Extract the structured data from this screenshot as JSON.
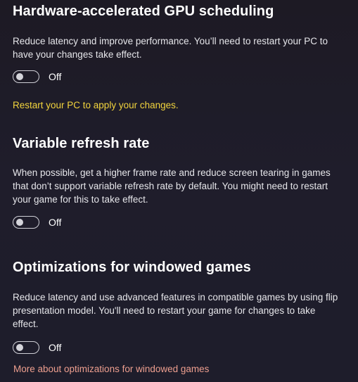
{
  "sections": [
    {
      "title": "Hardware-accelerated GPU scheduling",
      "description": "Reduce latency and improve performance. You’ll need to restart your PC to have your changes take effect.",
      "toggle": {
        "state": "Off"
      },
      "notice": "Restart your PC to apply your changes."
    },
    {
      "title": "Variable refresh rate",
      "description": "When possible, get a higher frame rate and reduce screen tearing in games that don’t support variable refresh rate by default. You might need to restart your game for this to take effect.",
      "toggle": {
        "state": "Off"
      }
    },
    {
      "title": "Optimizations for windowed games",
      "description": "Reduce latency and use advanced features in compatible games by using flip presentation model. You'll need to restart your game for changes to take effect.",
      "toggle": {
        "state": "Off"
      },
      "link": "More about optimizations for windowed games"
    }
  ],
  "colors": {
    "background": "#1f1d2b",
    "notice": "#f2d43d",
    "link": "#ee9f8f",
    "toggle_border": "#cfcfd6"
  },
  "icons": {
    "toggle_knob": "toggle-off-knob"
  }
}
